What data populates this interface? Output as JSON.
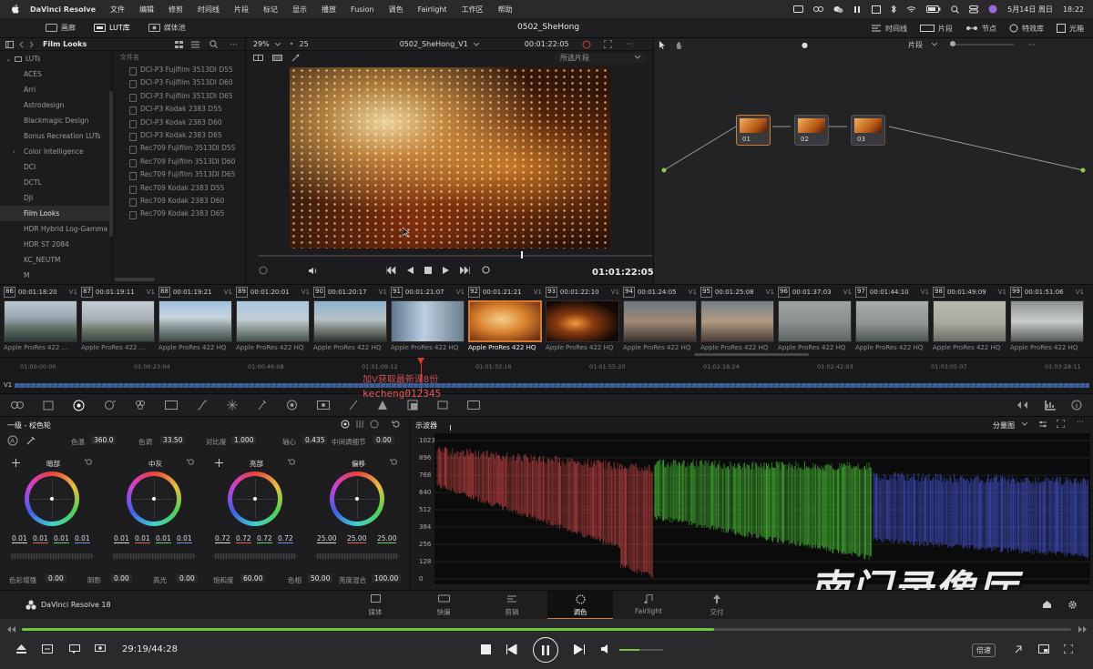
{
  "menubar": {
    "app": "DaVinci Resolve",
    "items": [
      "文件",
      "编辑",
      "修剪",
      "时间线",
      "片段",
      "标记",
      "显示",
      "播放",
      "Fusion",
      "调色",
      "Fairlight",
      "工作区",
      "帮助"
    ],
    "date": "5月14日 周日",
    "time": "18:22"
  },
  "toolbar": {
    "media": "画廊",
    "lut": "LUT库",
    "mediapool": "媒体池",
    "project_title": "0502_SheHong",
    "timeline_btn": "时间线",
    "clips_btn": "片段",
    "nodes_btn": "节点",
    "effects_btn": "特效库",
    "light_btn": "光箱"
  },
  "lut_panel": {
    "title": "Film Looks",
    "tree": [
      "LUTs",
      "ACES",
      "Arri",
      "Astrodesign",
      "Blackmagic Design",
      "Bonus Recreation LUTs",
      "Color Intelligence",
      "DCI",
      "DCTL",
      "DJI",
      "Film Looks",
      "HDR Hybrid Log-Gamma",
      "HDR ST 2084",
      "KC_NEUTM",
      "M"
    ],
    "list_header": "文件名",
    "files": [
      "DCI-P3 Fujifilm 3513DI D55",
      "DCI-P3 Fujifilm 3513DI D60",
      "DCI-P3 Fujifilm 3513DI D65",
      "DCI-P3 Kodak 2383 D55",
      "DCI-P3 Kodak 2383 D60",
      "DCI-P3 Kodak 2383 D65",
      "Rec709 Fujifilm 3513DI D55",
      "Rec709 Fujifilm 3513DI D60",
      "Rec709 Fujifilm 3513DI D65",
      "Rec709 Kodak 2383 D55",
      "Rec709 Kodak 2383 D60",
      "Rec709 Kodak 2383 D65"
    ]
  },
  "viewer": {
    "zoom": "29%",
    "fps": "25",
    "timeline_name": "0502_SheHong_V1",
    "top_tc": "00:01:22:05",
    "clip_filter": "所选片段",
    "bottom_tc": "01:01:22:05"
  },
  "node_panel": {
    "mode": "片段",
    "nodes": [
      "01",
      "02",
      "03"
    ]
  },
  "clips": [
    {
      "num": "86",
      "tc": "00:01:18:20",
      "track": "V1",
      "codec": "Apple ProRes 422 ..."
    },
    {
      "num": "87",
      "tc": "00:01:19:11",
      "track": "V1",
      "codec": "Apple ProRes 422 ..."
    },
    {
      "num": "88",
      "tc": "00:01:19:21",
      "track": "V1",
      "codec": "Apple ProRes 422 HQ"
    },
    {
      "num": "89",
      "tc": "00:01:20:01",
      "track": "V1",
      "codec": "Apple ProRes 422 HQ"
    },
    {
      "num": "90",
      "tc": "00:01:20:17",
      "track": "V1",
      "codec": "Apple ProRes 422 HQ"
    },
    {
      "num": "91",
      "tc": "00:01:21:07",
      "track": "V1",
      "codec": "Apple ProRes 422 HQ"
    },
    {
      "num": "92",
      "tc": "00:01:21:21",
      "track": "V1",
      "codec": "Apple ProRes 422 HQ"
    },
    {
      "num": "93",
      "tc": "00:01:22:10",
      "track": "V1",
      "codec": "Apple ProRes 422 HQ"
    },
    {
      "num": "94",
      "tc": "00:01:24:05",
      "track": "V1",
      "codec": "Apple ProRes 422 HQ"
    },
    {
      "num": "95",
      "tc": "00:01:25:08",
      "track": "V1",
      "codec": "Apple ProRes 422 HQ"
    },
    {
      "num": "96",
      "tc": "00:01:37:03",
      "track": "V1",
      "codec": "Apple ProRes 422 HQ"
    },
    {
      "num": "97",
      "tc": "00:01:44:10",
      "track": "V1",
      "codec": "Apple ProRes 422 HQ"
    },
    {
      "num": "98",
      "tc": "00:01:49:09",
      "track": "V1",
      "codec": "Apple ProRes 422 HQ"
    },
    {
      "num": "99",
      "tc": "00:01:51:06",
      "track": "V1",
      "codec": "Apple ProRes 422 HQ"
    }
  ],
  "timeline": {
    "track": "V1",
    "timecodes": [
      "01:00:00:00",
      "01:00:23:04",
      "01:00:46:08",
      "01:01:09:12",
      "01:01:32:16",
      "01:01:55:20",
      "01:02:18:24",
      "01:02:42:03",
      "01:03:05:07",
      "01:03:28:11"
    ],
    "overlay_line1": "加V获取最新课8份",
    "overlay_line2": "kecheng012345"
  },
  "wheels": {
    "title": "一级 - 校色轮",
    "top_params": [
      {
        "label": "色温",
        "value": "360.0"
      },
      {
        "label": "色调",
        "value": "33.50"
      },
      {
        "label": "对比度",
        "value": "1.000"
      },
      {
        "label": "轴心",
        "value": "0.435"
      },
      {
        "label": "中间调细节",
        "value": "0.00"
      }
    ],
    "items": [
      {
        "name": "暗部",
        "values": [
          "0.01",
          "0.01",
          "0.01",
          "0.01"
        ]
      },
      {
        "name": "中灰",
        "values": [
          "0.01",
          "0.01",
          "0.01",
          "0.01"
        ]
      },
      {
        "name": "亮部",
        "values": [
          "0.72",
          "0.72",
          "0.72",
          "0.72"
        ]
      },
      {
        "name": "偏移",
        "values": [
          "25.00",
          "25.00",
          "25.00",
          ""
        ]
      }
    ],
    "bottom_params": [
      {
        "label": "色彩增强",
        "value": "0.00"
      },
      {
        "label": "阴影",
        "value": "0.00"
      },
      {
        "label": "高光",
        "value": "0.00"
      },
      {
        "label": "饱和度",
        "value": "60.00"
      },
      {
        "label": "色相",
        "value": "50.00"
      },
      {
        "label": "亮度混合",
        "value": "100.00"
      }
    ]
  },
  "scope": {
    "title": "示波器",
    "mode": "分量图",
    "ticks": [
      "1023",
      "896",
      "768",
      "640",
      "512",
      "384",
      "256",
      "128",
      "0"
    ]
  },
  "pages": [
    {
      "label": "媒体"
    },
    {
      "label": "快编"
    },
    {
      "label": "剪辑"
    },
    {
      "label": "调色"
    },
    {
      "label": "Fairlight"
    },
    {
      "label": "交付"
    }
  ],
  "brand": "DaVinci Resolve 18",
  "player": {
    "time": "29:19/44:28",
    "progress": 0.66,
    "speed_label": "倍速",
    "volume": 0.45
  },
  "watermark": "南门录像厅",
  "colors": {
    "accent": "#d9782e",
    "progress": "#6ec63c"
  }
}
